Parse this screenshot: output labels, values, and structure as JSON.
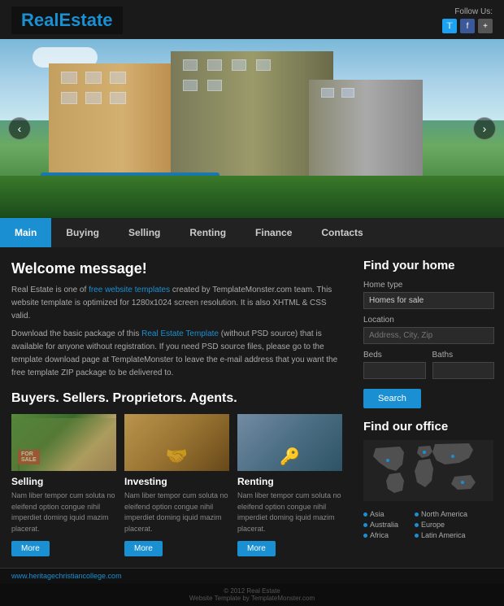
{
  "header": {
    "logo_real": "Real",
    "logo_estate": "Estate",
    "follow_label": "Follow Us:",
    "social_icons": [
      "t",
      "f",
      "+"
    ]
  },
  "nav": {
    "items": [
      {
        "label": "Main",
        "active": true
      },
      {
        "label": "Buying",
        "active": false
      },
      {
        "label": "Selling",
        "active": false
      },
      {
        "label": "Renting",
        "active": false
      },
      {
        "label": "Finance",
        "active": false
      },
      {
        "label": "Contacts",
        "active": false
      }
    ]
  },
  "welcome": {
    "title": "Welcome message!",
    "paragraph1": "Real Estate is one of free website templates created by TemplateMonster.com team. This website template is optimized for 1280x1024 screen resolution. It is also XHTML & CSS valid.",
    "paragraph2": "Download the basic package of this Real Estate Template (without PSD source) that is available for anyone without registration. If you need PSD source files, please go to the template download page at TemplateMonster to leave the e-mail address that you want the free template ZIP package to be delivered to."
  },
  "section": {
    "title": "Buyers. Sellers. Proprietors. Agents."
  },
  "cards": [
    {
      "label": "Selling",
      "text": "Nam liber tempor cum soluta no eleifend option congue nihil imperdiet doming iquid mazim placerat.",
      "btn": "More",
      "type": "selling"
    },
    {
      "label": "Investing",
      "text": "Nam liber tempor cum soluta no eleifend option congue nihil imperdiet doming iquid mazim placerat.",
      "btn": "More",
      "type": "investing"
    },
    {
      "label": "Renting",
      "text": "Nam liber tempor cum soluta no eleifend option congue nihil imperdiet doming iquid mazim placerat.",
      "btn": "More",
      "type": "renting"
    }
  ],
  "sidebar": {
    "find_title": "Find your home",
    "home_type_label": "Home type",
    "home_type_value": "Homes for sale",
    "location_label": "Location",
    "location_placeholder": "Address, City, Zip",
    "beds_label": "Beds",
    "baths_label": "Baths",
    "search_btn": "Search",
    "office_title": "Find our office",
    "regions_left": [
      "Asia",
      "Australia",
      "Africa"
    ],
    "regions_right": [
      "North America",
      "Europe",
      "Latin America"
    ]
  },
  "footer": {
    "url": "www.heritagechristiancollege.com",
    "copyright": "© 2012 Real Estate",
    "credit": "Website Template by TemplateMonster.com"
  }
}
